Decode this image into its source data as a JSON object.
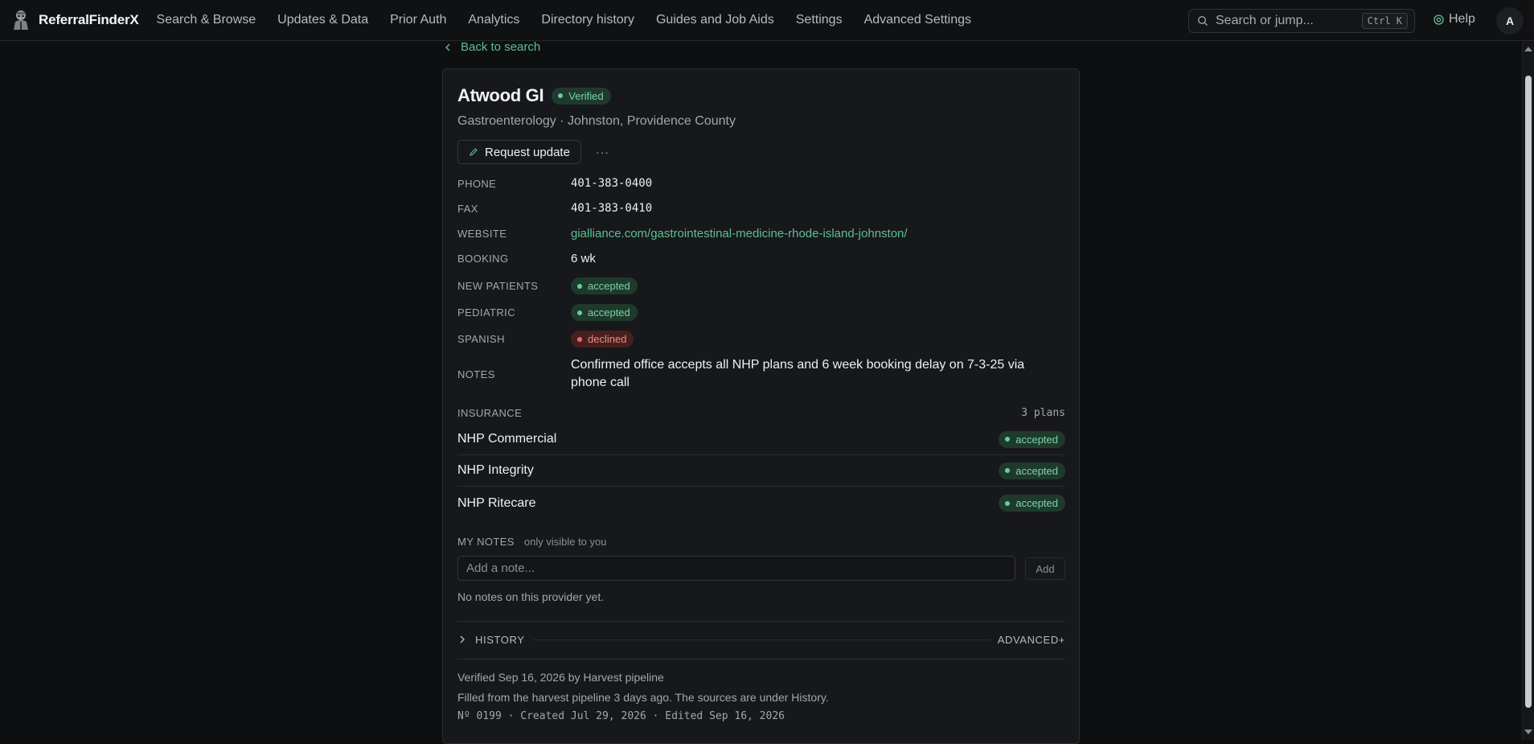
{
  "app": {
    "name": "ReferralFinderX",
    "nav": [
      "Search & Browse",
      "Updates & Data",
      "Prior Auth",
      "Analytics",
      "Directory history",
      "Guides and Job Aids",
      "Settings",
      "Advanced Settings"
    ],
    "search_placeholder": "Search or jump...",
    "search_shortcut": "Ctrl K",
    "help_label": "Help",
    "avatar_initial": "A",
    "accent_color": "#5fbf93"
  },
  "back_link": "Back to search",
  "provider": {
    "name": "Atwood GI",
    "verified_label": "Verified",
    "subtitle": "Gastroenterology · Johnston, Providence County",
    "request_update_label": "Request update",
    "more_label": "···",
    "fields": {
      "phone": {
        "label": "PHONE",
        "value": "401-383-0400"
      },
      "fax": {
        "label": "FAX",
        "value": "401-383-0410"
      },
      "website": {
        "label": "WEBSITE",
        "value": "gialliance.com/gastrointestinal-medicine-rhode-island-johnston/"
      },
      "booking": {
        "label": "BOOKING",
        "value": "6 wk"
      },
      "new_patients": {
        "label": "NEW PATIENTS",
        "value": "accepted"
      },
      "pediatric": {
        "label": "PEDIATRIC",
        "value": "accepted"
      },
      "spanish": {
        "label": "SPANISH",
        "value": "declined"
      },
      "notes": {
        "label": "NOTES",
        "value": "Confirmed office accepts all NHP plans and 6 week booking delay on 7-3-25 via phone call"
      }
    },
    "insurance": {
      "label": "INSURANCE",
      "count": "3 plans",
      "plans": [
        {
          "name": "NHP Commercial",
          "status": "accepted"
        },
        {
          "name": "NHP Integrity",
          "status": "accepted"
        },
        {
          "name": "NHP Ritecare",
          "status": "accepted"
        }
      ]
    },
    "my_notes": {
      "label": "MY NOTES",
      "sub": "only visible to you",
      "placeholder": "Add a note...",
      "add_label": "Add",
      "empty": "No notes on this provider yet."
    },
    "history_label": "HISTORY",
    "advanced_label": "ADVANCED+",
    "verified_line": "Verified Sep 16, 2026 by Harvest pipeline",
    "filled_line": "Filled from the harvest pipeline 3 days ago. The sources are under History.",
    "record_line": "Nº 0199 · Created Jul 29, 2026 · Edited Sep 16, 2026"
  }
}
